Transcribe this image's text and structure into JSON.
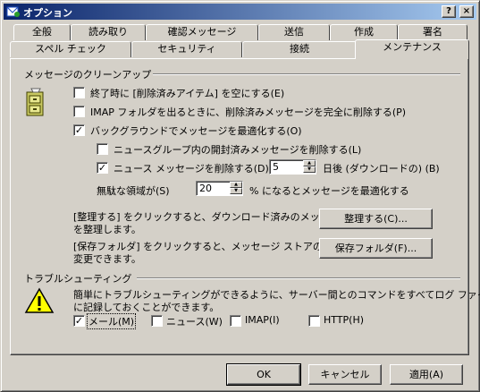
{
  "window": {
    "title": "オプション",
    "help_button": "?",
    "close_button": "×"
  },
  "tabs_row1": [
    {
      "label": "全般"
    },
    {
      "label": "読み取り"
    },
    {
      "label": "確認メッセージ"
    },
    {
      "label": "送信"
    },
    {
      "label": "作成"
    },
    {
      "label": "署名"
    }
  ],
  "tabs_row2": [
    {
      "label": "スペル チェック"
    },
    {
      "label": "セキュリティ"
    },
    {
      "label": "接続"
    },
    {
      "label": "メンテナンス",
      "active": true
    }
  ],
  "cleanup": {
    "group_label": "メッセージのクリーンアップ",
    "empty_deleted": {
      "label": "終了時に [削除済みアイテム] を空にする(E)",
      "checked": false
    },
    "purge_imap": {
      "label": "IMAP フォルダを出るときに、削除済みメッセージを完全に削除する(P)",
      "checked": false
    },
    "compact_background": {
      "label": "バックグラウンドでメッセージを最適化する(O)",
      "checked": true
    },
    "delete_read_news": {
      "label": "ニュースグループ内の開封済みメッセージを削除する(L)",
      "checked": false
    },
    "delete_news_days": {
      "label": "ニュース メッセージを削除する(D)",
      "checked": true,
      "value": "5",
      "suffix": "日後 (ダウンロードの) (B)"
    },
    "wasted_space": {
      "label": "無駄な領域が(S)",
      "value": "20",
      "suffix": "% になるとメッセージを最適化する"
    },
    "clean_up_text": [
      "[整理する] をクリックすると、ダウンロード済みのメッセージ",
      "を整理します。"
    ],
    "clean_up_button": "整理する(C)...",
    "store_text": [
      "[保存フォルダ] をクリックすると、メッセージ ストアの場所を",
      "変更できます。"
    ],
    "store_button": "保存フォルダ(F)..."
  },
  "troubleshooting": {
    "group_label": "トラブルシューティング",
    "desc": [
      "簡単にトラブルシューティングができるように、サーバー間とのコマンドをすべてログ ファイル",
      "に記録しておくことができます。"
    ],
    "options": [
      {
        "label": "メール(M)",
        "checked": true
      },
      {
        "label": "ニュース(W)",
        "checked": false
      },
      {
        "label": "IMAP(I)",
        "checked": false
      },
      {
        "label": "HTTP(H)",
        "checked": false
      }
    ]
  },
  "footer": {
    "ok": "OK",
    "cancel": "キャンセル",
    "apply": "適用(A)"
  }
}
